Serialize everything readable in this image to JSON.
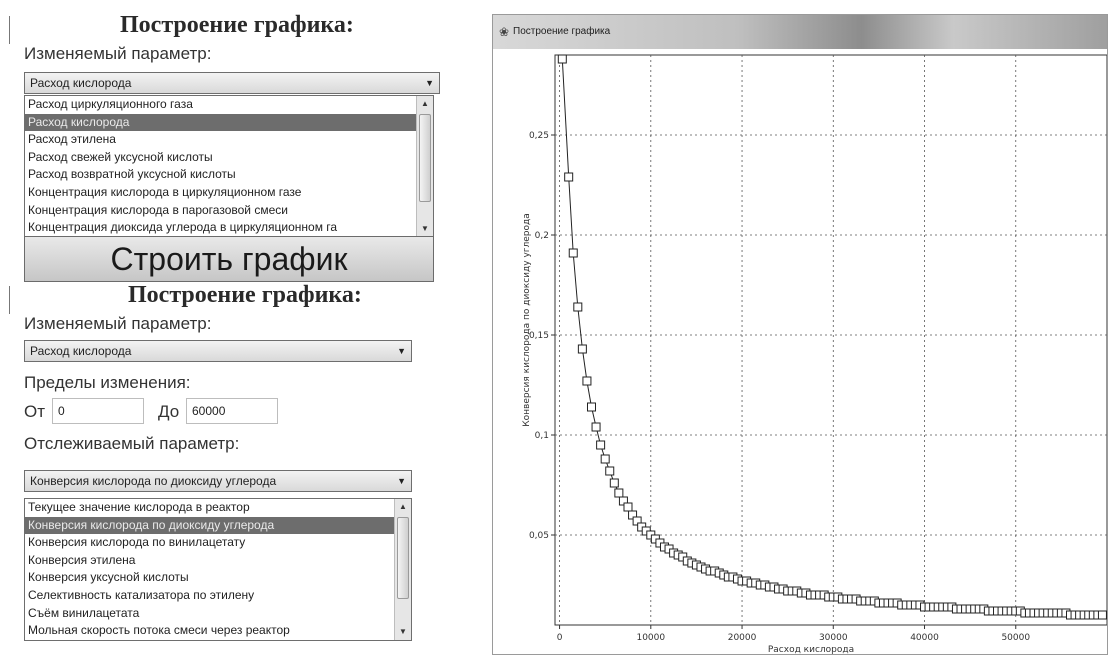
{
  "top_panel": {
    "title": "Построение графика:",
    "param_label": "Изменяемый параметр:",
    "combo_value": "Расход кислорода",
    "options": [
      "Расход циркуляционного газа",
      "Расход кислорода",
      "Расход этилена",
      "Расход свежей уксусной кислоты",
      "Расход возвратной уксусной кислоты",
      "Концентрация кислорода в циркуляционном газе",
      "Концентрация кислорода в парогазовой смеси",
      "Концентрация диоксида углерода в циркуляционном га"
    ],
    "selected_index": 1,
    "build_button": "Строить график"
  },
  "bottom_panel": {
    "title": "Построение графика:",
    "param_label": "Изменяемый параметр:",
    "combo_value": "Расход кислорода",
    "range_label": "Пределы изменения:",
    "from_label": "От",
    "from_value": "0",
    "to_label": "До",
    "to_value": "60000",
    "tracked_label": "Отслеживаемый параметр:",
    "tracked_value": "Конверсия кислорода по диоксиду углерода",
    "tracked_options": [
      "Текущее значение кислорода в реактор",
      "Конверсия кислорода по диоксиду углерода",
      "Конверсия кислорода по винилацетату",
      "Конверсия этилена",
      "Конверсия уксусной кислоты",
      "Селективность катализатора по этилену",
      "Съём винилацетата",
      "Мольная скорость потока смеси через реактор"
    ],
    "tracked_selected_index": 1
  },
  "icons": {
    "dropdown": "chevron-down-icon",
    "scroll_up": "scroll-up-icon",
    "scroll_down": "scroll-down-icon",
    "app": "app-icon"
  },
  "colors": {
    "selection": "#6d6d6d",
    "plot_line": "#222222",
    "grid": "#555555"
  },
  "plot_window": {
    "title": "Построение графика"
  },
  "chart_data": {
    "type": "line",
    "xlabel": "Расход кислорода",
    "ylabel": "Конверсия кислорода по диоксиду углерода",
    "x_ticks": [
      0,
      10000,
      20000,
      30000,
      40000,
      50000
    ],
    "x_tick_labels": [
      "0",
      "10000",
      "20000",
      "30000",
      "40000",
      "50000"
    ],
    "y_ticks": [
      0.05,
      0.1,
      0.15,
      0.2,
      0.25
    ],
    "y_tick_labels": [
      "0,05",
      "0,1",
      "0,15",
      "0,2",
      "0,25"
    ],
    "xlim": [
      -500,
      60000
    ],
    "ylim": [
      0.005,
      0.29
    ],
    "grid": true,
    "marker": "square",
    "series": [
      {
        "x": [
          300,
          1000,
          1500,
          2000,
          2500,
          3000,
          3500,
          4000,
          4500,
          5000,
          5500,
          6000,
          6500,
          7000,
          7500,
          8000,
          8500,
          9000,
          9500,
          10000,
          10500,
          11000,
          11500,
          12000,
          12500,
          13000,
          13500,
          14000,
          14500,
          15000,
          15500,
          16000,
          16500,
          17000,
          17500,
          18000,
          18500,
          19000,
          19500,
          20000,
          20500,
          21000,
          21500,
          22000,
          22500,
          23000,
          23500,
          24000,
          24500,
          25000,
          25500,
          26000,
          26500,
          27000,
          27500,
          28000,
          28500,
          29000,
          29500,
          30000,
          30500,
          31000,
          31500,
          32000,
          32500,
          33000,
          33500,
          34000,
          34500,
          35000,
          35500,
          36000,
          36500,
          37000,
          37500,
          38000,
          38500,
          39000,
          39500,
          40000,
          40500,
          41000,
          41500,
          42000,
          42500,
          43000,
          43500,
          44000,
          44500,
          45000,
          45500,
          46000,
          46500,
          47000,
          47500,
          48000,
          48500,
          49000,
          49500,
          50000,
          50500,
          51000,
          51500,
          52000,
          52500,
          53000,
          53500,
          54000,
          54500,
          55000,
          55500,
          56000,
          56500,
          57000,
          57500,
          58000,
          58500,
          59000,
          59500
        ],
        "y": [
          0.288,
          0.229,
          0.191,
          0.164,
          0.143,
          0.127,
          0.114,
          0.104,
          0.095,
          0.088,
          0.082,
          0.076,
          0.071,
          0.067,
          0.064,
          0.06,
          0.057,
          0.054,
          0.052,
          0.05,
          0.048,
          0.046,
          0.044,
          0.043,
          0.041,
          0.04,
          0.039,
          0.037,
          0.036,
          0.035,
          0.034,
          0.033,
          0.032,
          0.032,
          0.031,
          0.03,
          0.029,
          0.029,
          0.028,
          0.027,
          0.027,
          0.026,
          0.026,
          0.025,
          0.025,
          0.024,
          0.024,
          0.023,
          0.023,
          0.022,
          0.022,
          0.022,
          0.021,
          0.021,
          0.02,
          0.02,
          0.02,
          0.02,
          0.019,
          0.019,
          0.019,
          0.018,
          0.018,
          0.018,
          0.018,
          0.017,
          0.017,
          0.017,
          0.017,
          0.016,
          0.016,
          0.016,
          0.016,
          0.016,
          0.015,
          0.015,
          0.015,
          0.015,
          0.015,
          0.014,
          0.014,
          0.014,
          0.014,
          0.014,
          0.014,
          0.014,
          0.013,
          0.013,
          0.013,
          0.013,
          0.013,
          0.013,
          0.013,
          0.012,
          0.012,
          0.012,
          0.012,
          0.012,
          0.012,
          0.012,
          0.012,
          0.011,
          0.011,
          0.011,
          0.011,
          0.011,
          0.011,
          0.011,
          0.011,
          0.011,
          0.011,
          0.01,
          0.01,
          0.01,
          0.01,
          0.01,
          0.01,
          0.01,
          0.01
        ]
      }
    ]
  }
}
